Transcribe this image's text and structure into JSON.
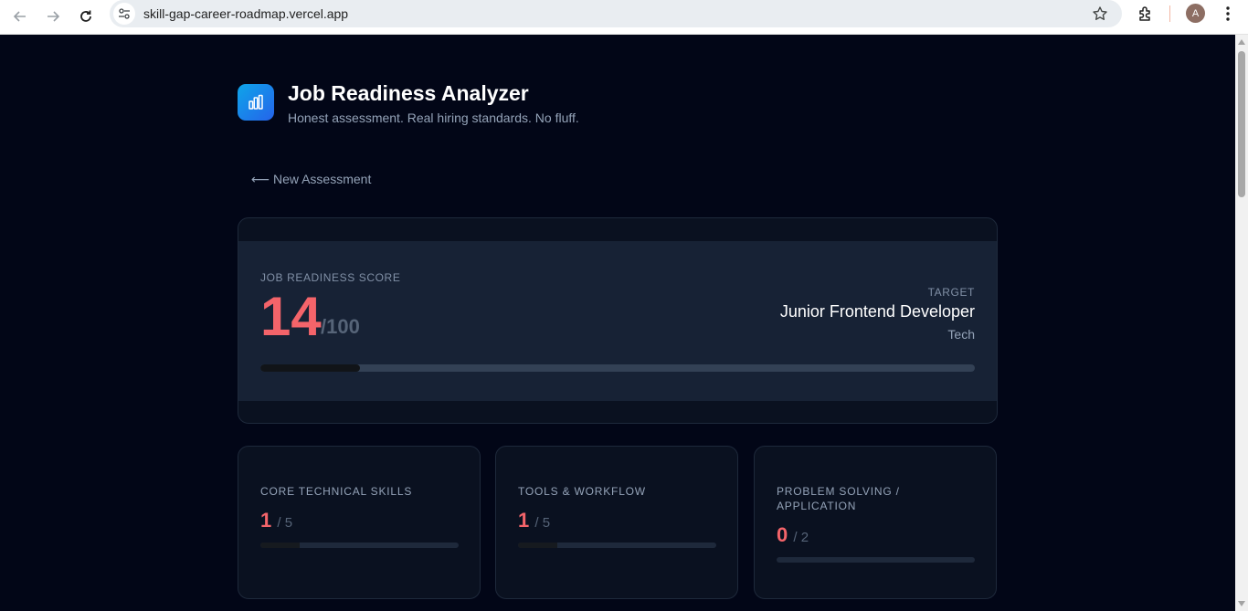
{
  "browser": {
    "url": "skill-gap-career-roadmap.vercel.app",
    "profile_initial": "A"
  },
  "app": {
    "title": "Job Readiness Analyzer",
    "subtitle": "Honest assessment. Real hiring standards. No fluff.",
    "logo_icon": "bar-chart-icon"
  },
  "back_link": "⟵ New Assessment",
  "score": {
    "label": "JOB READINESS SCORE",
    "value": "14",
    "max": "/100",
    "fraction": 0.14,
    "target_label": "TARGET",
    "target_role": "Junior Frontend Developer",
    "target_category": "Tech"
  },
  "categories": [
    {
      "title": "CORE TECHNICAL SKILLS",
      "score": "1",
      "max": "/ 5",
      "fraction": 0.2
    },
    {
      "title": "TOOLS & WORKFLOW",
      "score": "1",
      "max": "/ 5",
      "fraction": 0.2
    },
    {
      "title": "PROBLEM SOLVING / APPLICATION",
      "score": "0",
      "max": "/ 2",
      "fraction": 0.0
    }
  ],
  "colors": {
    "background": "#020617",
    "score_accent": "#f4646a",
    "logo_gradient_start": "#0ea5e9",
    "logo_gradient_end": "#2563eb"
  }
}
